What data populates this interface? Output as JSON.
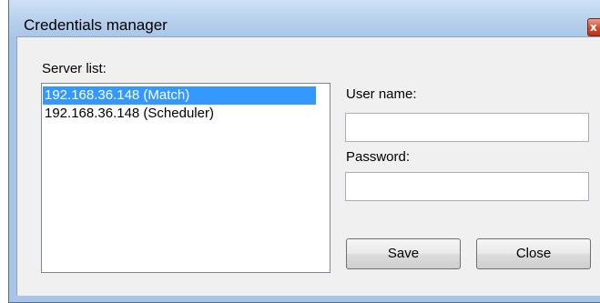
{
  "window": {
    "title": "Credentials manager",
    "close_glyph": "x"
  },
  "server_list": {
    "label": "Server list:",
    "items": [
      {
        "label": "192.168.36.148 (Match)",
        "selected": true
      },
      {
        "label": "192.168.36.148 (Scheduler)",
        "selected": false
      }
    ]
  },
  "username": {
    "label": "User name:",
    "value": "",
    "placeholder": ""
  },
  "password": {
    "label": "Password:",
    "value": "",
    "placeholder": ""
  },
  "buttons": {
    "save_label": "Save",
    "close_label": "Close"
  },
  "colors": {
    "selection": "#3399ff",
    "titlebar": "#bcd3ee",
    "close_button": "#cf4a2f"
  }
}
